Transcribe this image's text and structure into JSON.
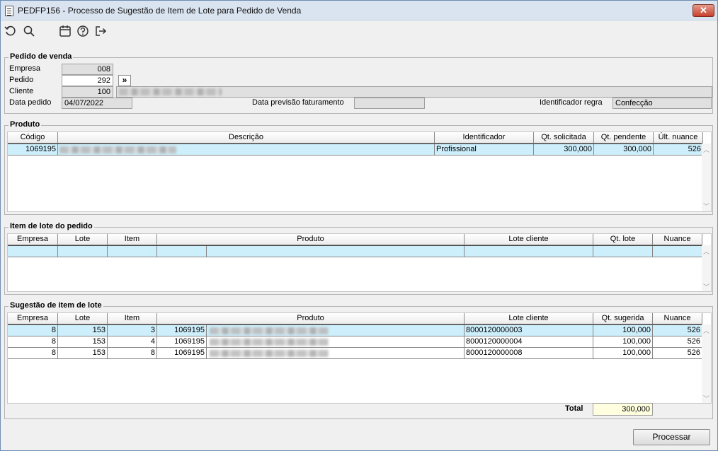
{
  "window": {
    "title": "PEDFP156 - Processo de Sugestão de Item de Lote para Pedido de Venda",
    "close_label": "✕"
  },
  "toolbar": {
    "icons": [
      "refresh-icon",
      "search-icon",
      "calendar-icon",
      "help-icon",
      "exit-icon"
    ]
  },
  "pedido": {
    "group_title": "Pedido de venda",
    "empresa_label": "Empresa",
    "empresa_value": "008",
    "pedido_label": "Pedido",
    "pedido_value": "292",
    "cliente_label": "Cliente",
    "cliente_value": "100",
    "data_pedido_label": "Data pedido",
    "data_pedido_value": "04/07/2022",
    "data_previsao_label": "Data previsão faturamento",
    "data_previsao_value": "",
    "identificador_label": "Identificador regra",
    "identificador_value": "Confecção",
    "expand_label": "»"
  },
  "produto": {
    "group_title": "Produto",
    "columns": [
      "Código",
      "Descrição",
      "Identificador",
      "Qt. solicitada",
      "Qt. pendente",
      "Últ. nuance"
    ],
    "rows": [
      {
        "codigo": "1069195",
        "descricao": "",
        "identificador": "Profissional",
        "qt_solicitada": "300,000",
        "qt_pendente": "300,000",
        "ult_nuance": "526"
      }
    ]
  },
  "item_lote": {
    "group_title": "Item de lote do pedido",
    "columns": [
      "Empresa",
      "Lote",
      "Item",
      "Produto",
      "Lote cliente",
      "Qt. lote",
      "Nuance"
    ]
  },
  "sugestao": {
    "group_title": "Sugestão de item de lote",
    "columns": [
      "Empresa",
      "Lote",
      "Item",
      "Produto",
      "Lote cliente",
      "Qt. sugerida",
      "Nuance"
    ],
    "rows": [
      {
        "empresa": "8",
        "lote": "153",
        "item": "3",
        "produto": "1069195",
        "lote_cliente": "8000120000003",
        "qt": "100,000",
        "nuance": "526"
      },
      {
        "empresa": "8",
        "lote": "153",
        "item": "4",
        "produto": "1069195",
        "lote_cliente": "8000120000004",
        "qt": "100,000",
        "nuance": "526"
      },
      {
        "empresa": "8",
        "lote": "153",
        "item": "8",
        "produto": "1069195",
        "lote_cliente": "8000120000008",
        "qt": "100,000",
        "nuance": "526"
      }
    ],
    "total_label": "Total",
    "total_value": "300,000"
  },
  "actions": {
    "processar_label": "Processar"
  }
}
